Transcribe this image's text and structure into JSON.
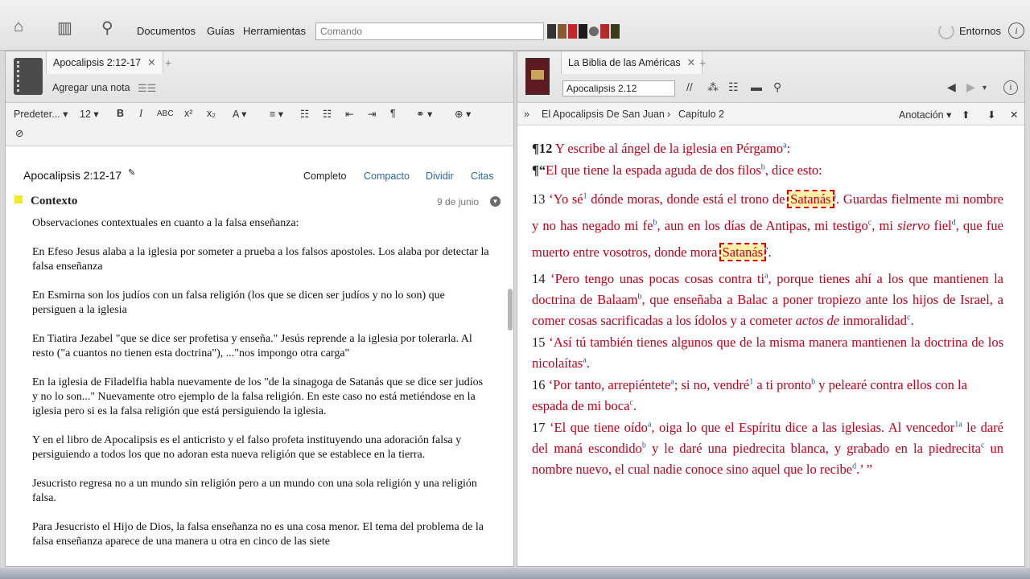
{
  "toolbar": {
    "menu": [
      "Documentos",
      "Guías",
      "Herramientas"
    ],
    "command_placeholder": "Comando",
    "environments": "Entornos",
    "book_colors": [
      "#333333",
      "#8a5a2b",
      "#c8242c",
      "#1b1b1b",
      "#6a6a6a",
      "#b22a2a",
      "#3a3a1a"
    ]
  },
  "left": {
    "tab_label": "Apocalipsis 2:12-17",
    "add_note": "Agregar una nota",
    "format": {
      "font": "Predeter...",
      "size": "12"
    },
    "note_title": "Apocalipsis 2:12-17",
    "views": [
      "Completo",
      "Compacto",
      "Dividir",
      "Citas"
    ],
    "context_label": "Contexto",
    "context_date": "9 de junio",
    "paragraphs": [
      "Observaciones contextuales en cuanto a la falsa enseñanza:",
      "En Efeso Jesus alaba a la iglesia por someter a prueba a los falsos apostoles.  Los alaba por detectar la falsa enseñanza",
      "En Esmirna son los judíos con un falsa religión (los que se dicen ser judíos y no lo son) que persiguen a la iglesia",
      "En Tiatira Jezabel \"que se dice ser profetisa y enseña.\" Jesús reprende a la iglesia por tolerarla.  Al resto (\"a cuantos no tienen esta doctrina\"), ...\"nos impongo otra carga\"",
      "En la iglesia de Filadelfia habla nuevamente de los \"de la sinagoga de Satanás que se dice ser judíos y no lo son...\"  Nuevamente otro ejemplo de la falsa religión.  En este caso no está metiéndose en la iglesia pero si es la falsa religión que está persiguiendo la iglesia.",
      "Y en el libro de Apocalipsis es el anticristo y el falso profeta instituyendo una adoración falsa y persiguiendo a todos los que no adoran esta nueva religión que se establece en la tierra.",
      "Jesucristo regresa no a un mundo sin religión pero a un mundo con una sola religión y una religión falsa.",
      "Para Jesucristo el Hijo de Dios, la falsa enseñanza no es una cosa menor.  El tema del problema de la falsa enseñanza aparece de una manera u otra en cinco de las siete"
    ]
  },
  "right": {
    "tab_label": "La Biblia de las Américas",
    "reference": "Apocalipsis 2.12",
    "breadcrumb": [
      "El Apocalipsis De San Juan",
      "Capítulo 2"
    ],
    "annotation": "Anotación",
    "verses": {
      "v12a_mark": "¶12",
      "v12a": " Y escribe al ángel de la iglesia en Pérgamo",
      "v12a_sup": "a",
      "v12a_end": ":",
      "v12b_mark": "¶“",
      "v12b": "El que tiene la espada aguda de dos filos",
      "v12b_sup": "b",
      "v12b_end": ", dice esto:",
      "v13_num": "13",
      "v13_a": " ‘Yo sé",
      "v13_sup1": "1",
      "v13_b": " dónde moras, donde está el trono de ",
      "satan": "Satanás",
      "v13_sup2": "a",
      "v13_c": ". Guardas fielmente mi nombre y no has negado mi fe",
      "v13_sup3": "b",
      "v13_d": ", aun en los días de Antipas, mi testigo",
      "v13_sup4": "c",
      "v13_e": ", mi ",
      "v13_siervo": "siervo",
      "v13_f": " fiel",
      "v13_sup5": "d",
      "v13_g": ", que fue muerto entre vosotros, donde mora ",
      "v13_sup6": "e",
      "v13_h": ".",
      "v14_num": "14",
      "v14_a": " ‘Pero tengo unas pocas cosas contra ti",
      "v14_sup1": "a",
      "v14_b": ", porque tienes ahí a los que mantienen la doctrina de Balaam",
      "v14_sup2": "b",
      "v14_c": ", que enseñaba a Balac a poner tropiezo ante los hijos de Israel, a comer cosas sacrificadas a los ídolos y a cometer ",
      "v14_it": "actos de",
      "v14_d": " inmoralidad",
      "v14_sup3": "c",
      "v14_e": ".",
      "v15_num": "15",
      "v15_a": " ‘Así tú también tienes algunos que de la misma manera mantienen la doctrina de los nicolaítas",
      "v15_sup": "a",
      "v15_b": ".",
      "v16_num": "16",
      "v16_a": " ‘Por tanto, arrepiéntete",
      "v16_sup1": "a",
      "v16_b": "; si no, vendré",
      "v16_sup2": "1",
      "v16_c": " a ti pronto",
      "v16_sup3": "b",
      "v16_d": " y pelearé contra ellos con la espada de mi boca",
      "v16_sup4": "c",
      "v16_e": ".",
      "v17_num": "17",
      "v17_a": " ‘El que tiene oído",
      "v17_sup1": "a",
      "v17_b": ", oiga lo que el Espíritu dice a las iglesias. Al vencedor",
      "v17_sup2": "1a",
      "v17_c": " le daré del maná escondido",
      "v17_sup3": "b",
      "v17_d": " y le daré una piedrecita blanca, y grabado en la piedrecita",
      "v17_sup4": "c",
      "v17_e": " un nombre nuevo, el cual nadie conoce sino aquel que lo recibe",
      "v17_sup5": "d",
      "v17_f": ".’ ”"
    }
  },
  "colors": {
    "scripture_red": "#c00018",
    "link_blue": "#2b6aa6",
    "highlight": "#fff2a8"
  }
}
